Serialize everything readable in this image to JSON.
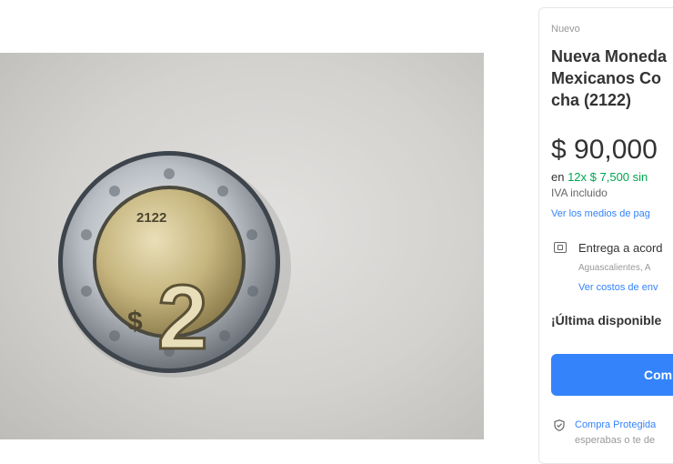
{
  "product": {
    "condition": "Nuevo",
    "title": "Nueva Moneda\nMexicanos Co\ncha (2122)",
    "price": "$ 90,000",
    "installments_prefix": "en ",
    "installments_offer": "12x $ 7,500 sin",
    "iva": "IVA incluido",
    "payment_link": "Ver los medios de pag"
  },
  "coin": {
    "year": "2122",
    "denomination": "2",
    "currency_sign": "$"
  },
  "delivery": {
    "icon": "map-icon",
    "label": "Entrega a acord",
    "location": "Aguascalientes, A",
    "shipping_link": "Ver costos de env"
  },
  "stock": {
    "availability": "¡Última disponible"
  },
  "actions": {
    "buy_label": "Com"
  },
  "protection": {
    "icon": "shield-icon",
    "link": "Compra Protegida",
    "text": "esperabas o te de"
  },
  "colors": {
    "accent": "#3483fa",
    "green": "#00a650"
  }
}
